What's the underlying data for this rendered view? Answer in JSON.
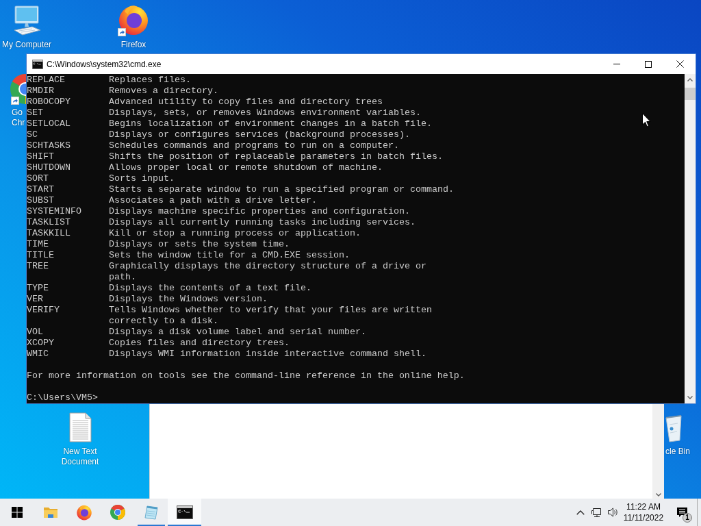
{
  "desktop": {
    "icons": [
      {
        "kind": "computer",
        "label_lines": [
          "My Computer"
        ],
        "shortcut": false
      },
      {
        "kind": "firefox",
        "label_lines": [
          "Firefox"
        ],
        "shortcut": true
      },
      {
        "kind": "chrome",
        "label_lines": [
          "Go",
          "Chr"
        ],
        "shortcut": true
      },
      {
        "kind": "document",
        "label_lines": [
          "New Text",
          "Document"
        ],
        "shortcut": false
      },
      {
        "kind": "bin",
        "label_lines": [
          "cle Bin"
        ],
        "shortcut": false
      }
    ]
  },
  "console_window": {
    "title": "C:\\Windows\\system32\\cmd.exe",
    "commands": [
      {
        "command": "REPLACE",
        "description_lines": [
          "Replaces files."
        ]
      },
      {
        "command": "RMDIR",
        "description_lines": [
          "Removes a directory."
        ]
      },
      {
        "command": "ROBOCOPY",
        "description_lines": [
          "Advanced utility to copy files and directory trees"
        ]
      },
      {
        "command": "SET",
        "description_lines": [
          "Displays, sets, or removes Windows environment variables."
        ]
      },
      {
        "command": "SETLOCAL",
        "description_lines": [
          "Begins localization of environment changes in a batch file."
        ]
      },
      {
        "command": "SC",
        "description_lines": [
          "Displays or configures services (background processes)."
        ]
      },
      {
        "command": "SCHTASKS",
        "description_lines": [
          "Schedules commands and programs to run on a computer."
        ]
      },
      {
        "command": "SHIFT",
        "description_lines": [
          "Shifts the position of replaceable parameters in batch files."
        ]
      },
      {
        "command": "SHUTDOWN",
        "description_lines": [
          "Allows proper local or remote shutdown of machine."
        ]
      },
      {
        "command": "SORT",
        "description_lines": [
          "Sorts input."
        ]
      },
      {
        "command": "START",
        "description_lines": [
          "Starts a separate window to run a specified program or command."
        ]
      },
      {
        "command": "SUBST",
        "description_lines": [
          "Associates a path with a drive letter."
        ]
      },
      {
        "command": "SYSTEMINFO",
        "description_lines": [
          "Displays machine specific properties and configuration."
        ]
      },
      {
        "command": "TASKLIST",
        "description_lines": [
          "Displays all currently running tasks including services."
        ]
      },
      {
        "command": "TASKKILL",
        "description_lines": [
          "Kill or stop a running process or application."
        ]
      },
      {
        "command": "TIME",
        "description_lines": [
          "Displays or sets the system time."
        ]
      },
      {
        "command": "TITLE",
        "description_lines": [
          "Sets the window title for a CMD.EXE session."
        ]
      },
      {
        "command": "TREE",
        "description_lines": [
          "Graphically displays the directory structure of a drive or",
          "path."
        ]
      },
      {
        "command": "TYPE",
        "description_lines": [
          "Displays the contents of a text file."
        ]
      },
      {
        "command": "VER",
        "description_lines": [
          "Displays the Windows version."
        ]
      },
      {
        "command": "VERIFY",
        "description_lines": [
          "Tells Windows whether to verify that your files are written",
          "correctly to a disk."
        ]
      },
      {
        "command": "VOL",
        "description_lines": [
          "Displays a disk volume label and serial number."
        ]
      },
      {
        "command": "XCOPY",
        "description_lines": [
          "Copies files and directory trees."
        ]
      },
      {
        "command": "WMIC",
        "description_lines": [
          "Displays WMI information inside interactive command shell."
        ]
      }
    ],
    "footer": "For more information on tools see the command-line reference in the online help.",
    "prompt": "C:\\Users\\VM5>"
  },
  "taskbar": {
    "apps": [
      {
        "kind": "folder",
        "running": false,
        "selected": false
      },
      {
        "kind": "firefox",
        "running": false,
        "selected": false
      },
      {
        "kind": "chrome",
        "running": false,
        "selected": false
      },
      {
        "kind": "notepad",
        "running": true,
        "selected": false
      },
      {
        "kind": "console",
        "running": true,
        "selected": true
      }
    ],
    "clock": {
      "time": "11:22 AM",
      "date": "11/11/2022"
    },
    "notifications": {
      "count": "1"
    }
  }
}
